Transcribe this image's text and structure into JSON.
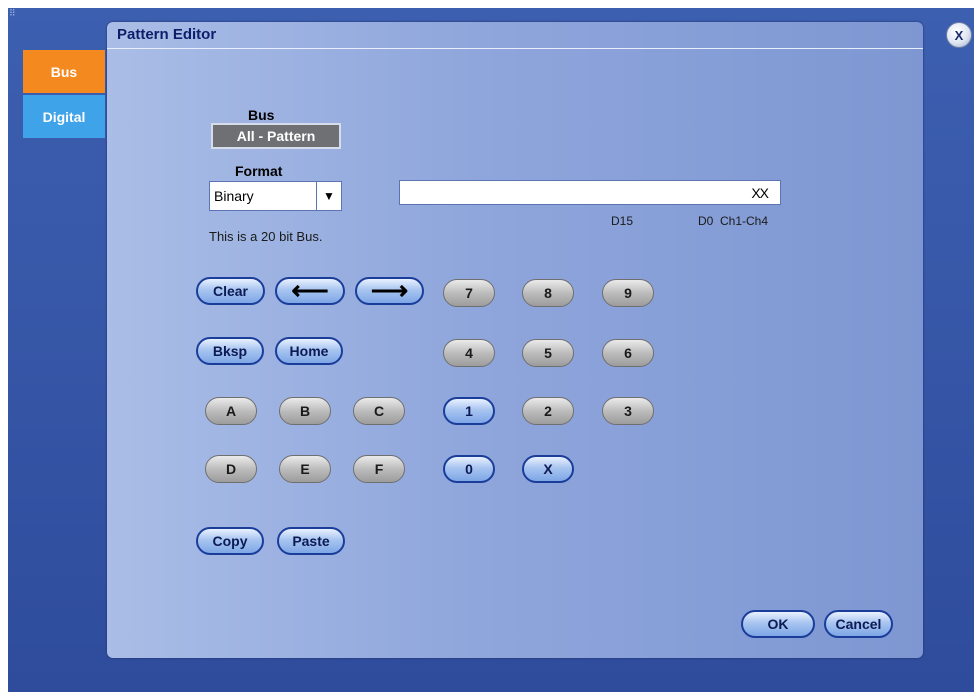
{
  "dialog": {
    "title": "Pattern Editor",
    "close_label": "X"
  },
  "tabs": [
    {
      "label": "Bus",
      "selected": true
    },
    {
      "label": "Digital",
      "selected": false
    }
  ],
  "bus": {
    "label": "Bus",
    "value": "All - Pattern"
  },
  "format": {
    "label": "Format",
    "selected": "Binary",
    "arrow": "▼"
  },
  "info_text": "This is a 20 bit Bus.",
  "pattern": {
    "value": "XX",
    "label_msb": "D15",
    "label_lsb": "D0  Ch1-Ch4"
  },
  "keys": {
    "clear": "Clear",
    "left_arrow": "⟵",
    "right_arrow": "⟶",
    "bksp": "Bksp",
    "home": "Home",
    "k7": "7",
    "k8": "8",
    "k9": "9",
    "k4": "4",
    "k5": "5",
    "k6": "6",
    "k1": "1",
    "k2": "2",
    "k3": "3",
    "k0": "0",
    "kx": "X",
    "ka": "A",
    "kb": "B",
    "kc": "C",
    "kd": "D",
    "ke": "E",
    "kf": "F",
    "copy": "Copy",
    "paste": "Paste"
  },
  "footer": {
    "ok": "OK",
    "cancel": "Cancel"
  },
  "colors": {
    "bus_tab": "#f48a1f",
    "digital_tab": "#3ea3e8",
    "enabled_button_border": "#1b3d9a",
    "disabled_button": "#9c9c9c"
  }
}
